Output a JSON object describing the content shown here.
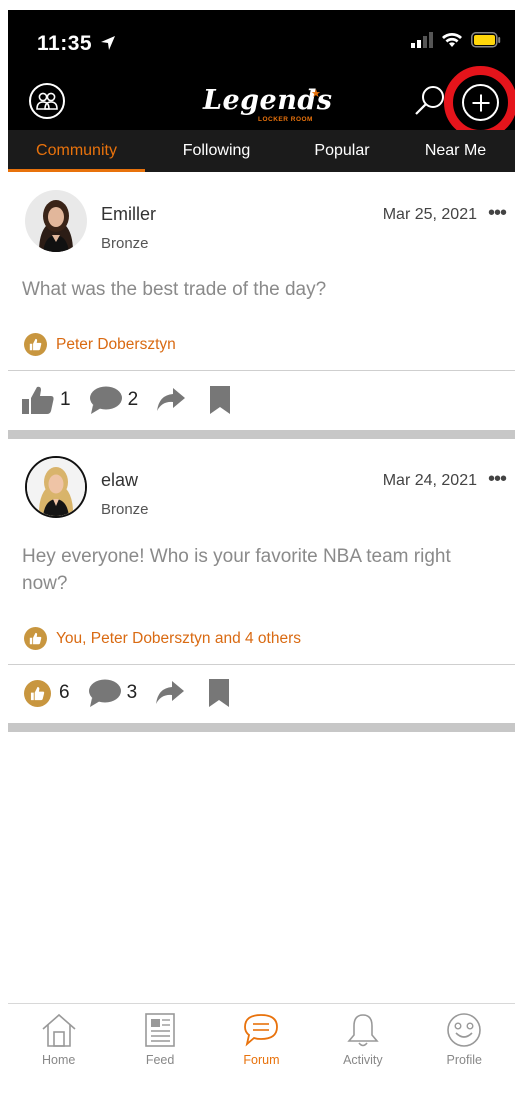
{
  "status_bar": {
    "time": "11:35"
  },
  "header": {
    "logo_text": "Legends",
    "logo_subtitle": "LOCKER ROOM"
  },
  "tabs": [
    {
      "label": "Community",
      "active": true
    },
    {
      "label": "Following",
      "active": false
    },
    {
      "label": "Popular",
      "active": false
    },
    {
      "label": "Near Me",
      "active": false
    }
  ],
  "posts": [
    {
      "username": "Emiller",
      "rank": "Bronze",
      "date": "Mar 25, 2021",
      "text": "What was the best trade of the day?",
      "liked_by": "Peter Dobersztyn",
      "like_count": "1",
      "comment_count": "2",
      "liked_by_me": false
    },
    {
      "username": "elaw",
      "rank": "Bronze",
      "date": "Mar 24, 2021",
      "text": "Hey everyone! Who is your favorite NBA team right now?",
      "liked_by": "You, Peter Dobersztyn and 4 others",
      "like_count": "6",
      "comment_count": "3",
      "liked_by_me": true
    }
  ],
  "more_glyph": "•••",
  "bottom_nav": [
    {
      "label": "Home",
      "icon": "home-icon",
      "active": false
    },
    {
      "label": "Feed",
      "icon": "feed-icon",
      "active": false
    },
    {
      "label": "Forum",
      "icon": "forum-icon",
      "active": true
    },
    {
      "label": "Activity",
      "icon": "bell-icon",
      "active": false
    },
    {
      "label": "Profile",
      "icon": "smiley-icon",
      "active": false
    }
  ],
  "colors": {
    "accent": "#e8720c",
    "highlight_ring": "#e5141b",
    "like_gold": "#c8963f"
  }
}
